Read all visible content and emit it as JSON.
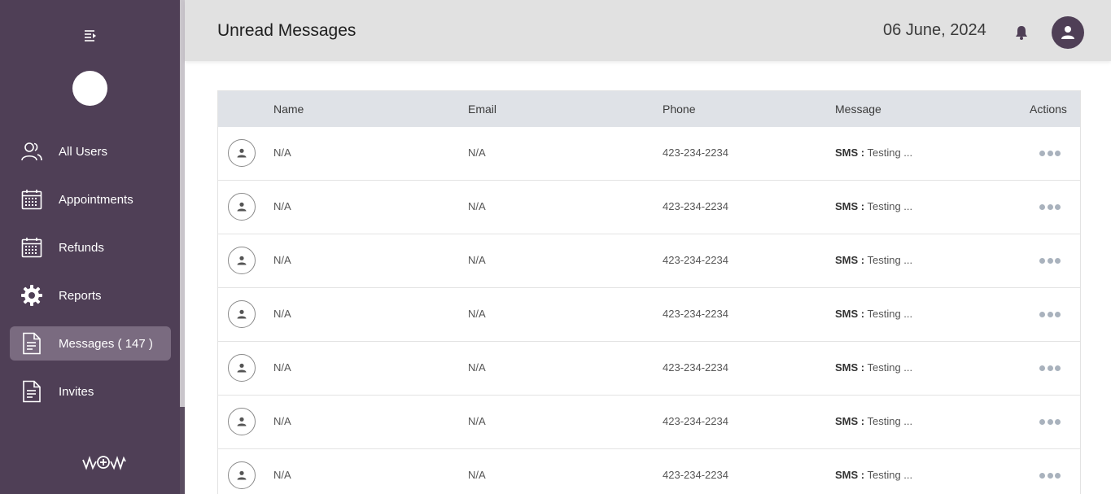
{
  "header": {
    "title": "Unread Messages",
    "date": "06 June, 2024"
  },
  "sidebar": {
    "items": [
      {
        "label": "All Users",
        "icon": "users-icon",
        "active": false
      },
      {
        "label": "Appointments",
        "icon": "calendar-icon",
        "active": false
      },
      {
        "label": "Refunds",
        "icon": "calendar-icon",
        "active": false
      },
      {
        "label": "Reports",
        "icon": "gear-icon",
        "active": false
      },
      {
        "label": "Messages ( 147 )",
        "icon": "document-icon",
        "active": true
      },
      {
        "label": "Invites",
        "icon": "document-icon",
        "active": false
      }
    ]
  },
  "table": {
    "columns": [
      "Name",
      "Email",
      "Phone",
      "Message",
      "Actions"
    ],
    "rows": [
      {
        "name": "N/A",
        "email": "N/A",
        "phone": "423-234-2234",
        "message_prefix": "SMS :",
        "message": " Testing ..."
      },
      {
        "name": "N/A",
        "email": "N/A",
        "phone": "423-234-2234",
        "message_prefix": "SMS :",
        "message": " Testing ..."
      },
      {
        "name": "N/A",
        "email": "N/A",
        "phone": "423-234-2234",
        "message_prefix": "SMS :",
        "message": " Testing ..."
      },
      {
        "name": "N/A",
        "email": "N/A",
        "phone": "423-234-2234",
        "message_prefix": "SMS :",
        "message": " Testing ..."
      },
      {
        "name": "N/A",
        "email": "N/A",
        "phone": "423-234-2234",
        "message_prefix": "SMS :",
        "message": " Testing ..."
      },
      {
        "name": "N/A",
        "email": "N/A",
        "phone": "423-234-2234",
        "message_prefix": "SMS :",
        "message": " Testing ..."
      },
      {
        "name": "N/A",
        "email": "N/A",
        "phone": "423-234-2234",
        "message_prefix": "SMS :",
        "message": " Testing ..."
      }
    ]
  },
  "colors": {
    "sidebar_bg": "#4f3f56",
    "active_item_bg": "#7a6b80",
    "header_bg": "#e1e1e1",
    "table_header_bg": "#dfe2e7"
  }
}
